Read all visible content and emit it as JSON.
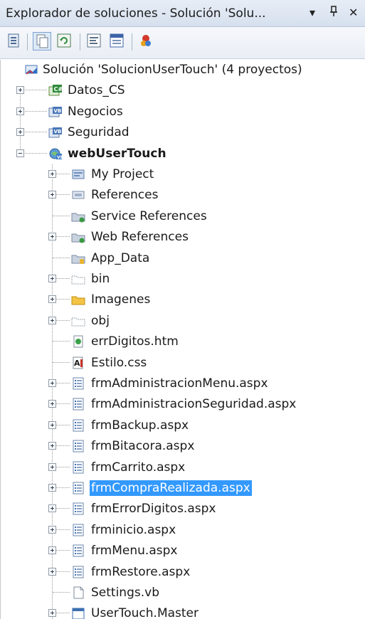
{
  "panel": {
    "title": "Explorador de soluciones - Solución 'Solu...",
    "controls": {
      "dropdown": "▾",
      "pin": "ᵖ",
      "close": "✕"
    }
  },
  "toolbar": {
    "buttons": [
      {
        "name": "properties-button",
        "icon": "properties-icon"
      },
      {
        "name": "show-all-files-button",
        "icon": "show-all-files-icon",
        "pressed": true
      },
      {
        "name": "refresh-button",
        "icon": "refresh-icon"
      },
      {
        "name": "view-code-button",
        "icon": "view-code-icon"
      },
      {
        "name": "view-designer-button",
        "icon": "view-designer-icon"
      },
      {
        "name": "class-diagram-button",
        "icon": "class-diagram-icon"
      }
    ]
  },
  "tree": {
    "items": [
      {
        "label": "Solución 'SolucionUserTouch'  (4 proyectos)",
        "icon": "solution-icon",
        "level": 0,
        "expander": "none"
      },
      {
        "label": "Datos_CS",
        "icon": "csharp-project-icon",
        "level": 1,
        "expander": "plus"
      },
      {
        "label": "Negocios",
        "icon": "vb-project-icon",
        "level": 1,
        "expander": "plus"
      },
      {
        "label": "Seguridad",
        "icon": "vb-project-icon",
        "level": 1,
        "expander": "plus"
      },
      {
        "label": "webUserTouch",
        "icon": "web-project-icon",
        "level": 1,
        "expander": "minus",
        "bold": true
      },
      {
        "label": "My Project",
        "icon": "my-project-icon",
        "level": 2,
        "expander": "plus"
      },
      {
        "label": "References",
        "icon": "references-icon",
        "level": 2,
        "expander": "plus"
      },
      {
        "label": "Service References",
        "icon": "service-references-icon",
        "level": 2,
        "expander": "none"
      },
      {
        "label": "Web References",
        "icon": "web-references-icon",
        "level": 2,
        "expander": "plus"
      },
      {
        "label": "App_Data",
        "icon": "app-data-folder-icon",
        "level": 2,
        "expander": "none"
      },
      {
        "label": "bin",
        "icon": "hidden-folder-icon",
        "level": 2,
        "expander": "plus"
      },
      {
        "label": "Imagenes",
        "icon": "folder-icon",
        "level": 2,
        "expander": "plus"
      },
      {
        "label": "obj",
        "icon": "hidden-folder-icon",
        "level": 2,
        "expander": "plus"
      },
      {
        "label": "errDigitos.htm",
        "icon": "html-file-icon",
        "level": 2,
        "expander": "none"
      },
      {
        "label": "Estilo.css",
        "icon": "css-file-icon",
        "level": 2,
        "expander": "none"
      },
      {
        "label": "frmAdministracionMenu.aspx",
        "icon": "aspx-file-icon",
        "level": 2,
        "expander": "plus"
      },
      {
        "label": "frmAdministracionSeguridad.aspx",
        "icon": "aspx-file-icon",
        "level": 2,
        "expander": "plus"
      },
      {
        "label": "frmBackup.aspx",
        "icon": "aspx-file-icon",
        "level": 2,
        "expander": "plus"
      },
      {
        "label": "frmBitacora.aspx",
        "icon": "aspx-file-icon",
        "level": 2,
        "expander": "plus"
      },
      {
        "label": "frmCarrito.aspx",
        "icon": "aspx-file-icon",
        "level": 2,
        "expander": "plus"
      },
      {
        "label": "frmCompraRealizada.aspx",
        "icon": "aspx-file-icon",
        "level": 2,
        "expander": "plus",
        "selected": true
      },
      {
        "label": "frmErrorDigitos.aspx",
        "icon": "aspx-file-icon",
        "level": 2,
        "expander": "plus"
      },
      {
        "label": "frminicio.aspx",
        "icon": "aspx-file-icon",
        "level": 2,
        "expander": "plus"
      },
      {
        "label": "frmMenu.aspx",
        "icon": "aspx-file-icon",
        "level": 2,
        "expander": "plus"
      },
      {
        "label": "frmRestore.aspx",
        "icon": "aspx-file-icon",
        "level": 2,
        "expander": "plus"
      },
      {
        "label": "Settings.vb",
        "icon": "vb-file-icon",
        "level": 2,
        "expander": "none"
      },
      {
        "label": "UserTouch.Master",
        "icon": "master-file-icon",
        "level": 2,
        "expander": "plus"
      }
    ]
  },
  "colors": {
    "selection": "#3399ff",
    "title_bar": "#dbe3ef",
    "toolbar": "#eef2f7"
  }
}
